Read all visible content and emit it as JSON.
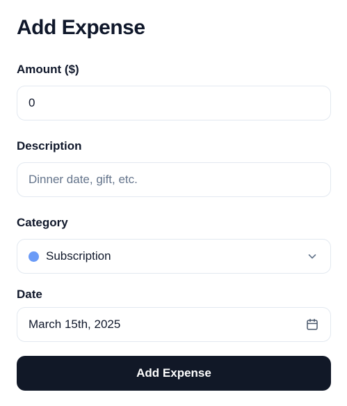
{
  "title": "Add Expense",
  "amount": {
    "label": "Amount ($)",
    "value": "0"
  },
  "description": {
    "label": "Description",
    "placeholder": "Dinner date, gift, etc.",
    "value": ""
  },
  "category": {
    "label": "Category",
    "selected": "Subscription",
    "dot_color": "#6b9bf7",
    "icon": "chevron-down-icon"
  },
  "date": {
    "label": "Date",
    "value": "March 15th, 2025",
    "icon": "calendar-icon"
  },
  "submit_label": "Add Expense",
  "colors": {
    "primary_button": "#111827",
    "border": "#e2e8f0",
    "placeholder": "#64748b",
    "text": "#0f172a"
  }
}
